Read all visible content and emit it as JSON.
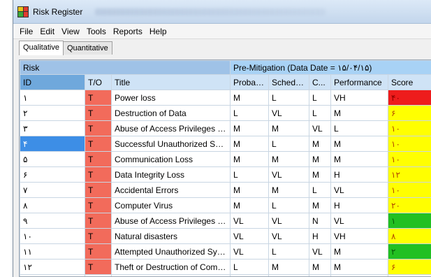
{
  "window": {
    "title": "Risk Register"
  },
  "menu": [
    "File",
    "Edit",
    "View",
    "Tools",
    "Reports",
    "Help"
  ],
  "tabs": [
    {
      "label": "Qualitative",
      "active": true
    },
    {
      "label": "Quantitative",
      "active": false
    }
  ],
  "grid": {
    "group_headers": {
      "risk": "Risk",
      "pre_mitigation": "Pre-Mitigation (Data Date = ۱۵/۰۴/۱۵)"
    },
    "columns": [
      "ID",
      "T/O",
      "Title",
      "Probability",
      "Schedule",
      "C...",
      "Performance",
      "Score"
    ],
    "rows": [
      {
        "id": "۱",
        "to": "T",
        "title": "Power loss",
        "probability": "M",
        "schedule": "L",
        "cost": "L",
        "performance": "VH",
        "score": "۴۰",
        "score_color": "red",
        "selected": false
      },
      {
        "id": "۲",
        "to": "T",
        "title": "Destruction of Data",
        "probability": "L",
        "schedule": "VL",
        "cost": "L",
        "performance": "M",
        "score": "۶",
        "score_color": "yellow",
        "selected": false
      },
      {
        "id": "۳",
        "to": "T",
        "title": "Abuse of Access Privileges by ...",
        "probability": "M",
        "schedule": "M",
        "cost": "VL",
        "performance": "L",
        "score": "۱۰",
        "score_color": "yellow",
        "selected": false
      },
      {
        "id": "۴",
        "to": "T",
        "title": "Successful Unauthorized Syste...",
        "probability": "M",
        "schedule": "L",
        "cost": "M",
        "performance": "M",
        "score": "۱۰",
        "score_color": "yellow",
        "selected": true
      },
      {
        "id": "۵",
        "to": "T",
        "title": "Communication Loss",
        "probability": "M",
        "schedule": "M",
        "cost": "M",
        "performance": "M",
        "score": "۱۰",
        "score_color": "yellow",
        "selected": false
      },
      {
        "id": "۶",
        "to": "T",
        "title": "Data Integrity Loss",
        "probability": "L",
        "schedule": "VL",
        "cost": "M",
        "performance": "H",
        "score": "۱۲",
        "score_color": "yellow",
        "selected": false
      },
      {
        "id": "۷",
        "to": "T",
        "title": "Accidental Errors",
        "probability": "M",
        "schedule": "M",
        "cost": "L",
        "performance": "VL",
        "score": "۱۰",
        "score_color": "yellow",
        "selected": false
      },
      {
        "id": "۸",
        "to": "T",
        "title": "Computer Virus",
        "probability": "M",
        "schedule": "L",
        "cost": "M",
        "performance": "H",
        "score": "۲۰",
        "score_color": "yellow",
        "selected": false
      },
      {
        "id": "۹",
        "to": "T",
        "title": "Abuse of Access Privileges by E...",
        "probability": "VL",
        "schedule": "VL",
        "cost": "N",
        "performance": "VL",
        "score": "۱",
        "score_color": "green",
        "selected": false
      },
      {
        "id": "۱۰",
        "to": "T",
        "title": "Natural disasters",
        "probability": "VL",
        "schedule": "VL",
        "cost": "H",
        "performance": "VH",
        "score": "۸",
        "score_color": "yellow",
        "selected": false
      },
      {
        "id": "۱۱",
        "to": "T",
        "title": "Attempted Unauthorized Syste...",
        "probability": "VL",
        "schedule": "L",
        "cost": "VL",
        "performance": "M",
        "score": "۲",
        "score_color": "green",
        "selected": false
      },
      {
        "id": "۱۲",
        "to": "T",
        "title": "Theft or Destruction of Compu...",
        "probability": "L",
        "schedule": "M",
        "cost": "M",
        "performance": "M",
        "score": "۶",
        "score_color": "yellow",
        "selected": false
      }
    ]
  }
}
